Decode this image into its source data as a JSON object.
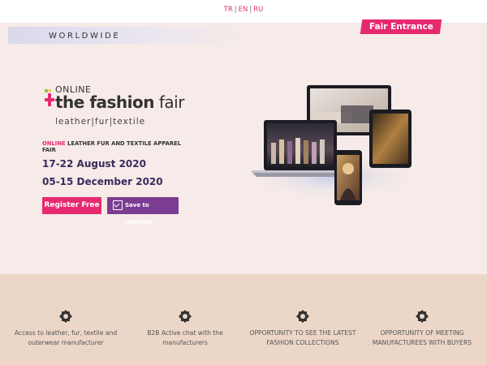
{
  "languages": [
    "TR",
    "EN",
    "RU"
  ],
  "banner": {
    "worldwide": "WORLDWIDE",
    "fair_entrance": "Fair Entrance"
  },
  "logo": {
    "online": "ONLINE",
    "name_bold": "the fashion",
    "name_light": " fair",
    "tagline": "leather|fur|textile"
  },
  "event": {
    "subtitle_highlight": "ONLINE",
    "subtitle_rest": " LEATHER FUR AND TEXTILE APPAREL FAIR",
    "date1": "17-22 August 2020",
    "date2": "05-15 December 2020"
  },
  "buttons": {
    "register": "Register Free",
    "calendar": "Save to calendar"
  },
  "features": [
    {
      "icon": "emblem-icon",
      "text": "Access to leather, fur, textile and outerwear manufacturer"
    },
    {
      "icon": "emblem-icon",
      "text": "B2B Active chat with the manufacturers"
    },
    {
      "icon": "emblem-icon",
      "text": "OPPORTUNITY TO SEE THE LATEST FASHION COLLECTIONS"
    },
    {
      "icon": "emblem-icon",
      "text": "OPPORTUNITY OF MEETING MANUFACTUREES WITH BUYERS"
    }
  ],
  "colors": {
    "accent": "#e72a6f",
    "purple": "#7b3d91",
    "date": "#3a2b5e"
  }
}
